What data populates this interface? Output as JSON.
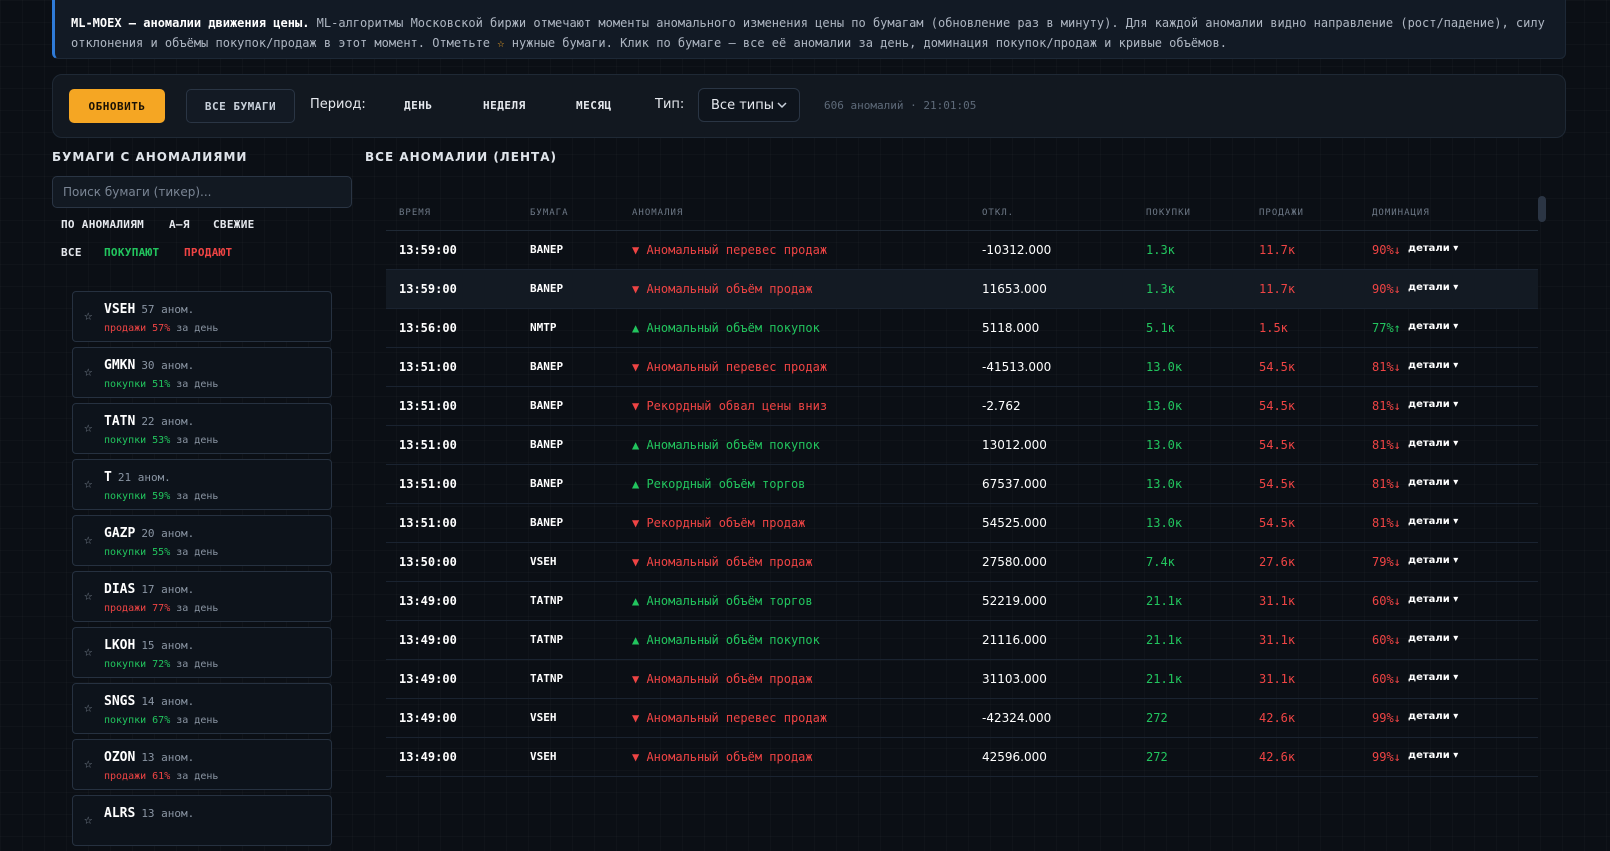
{
  "info": {
    "title": "ML-MOEX — аномалии движения цены.",
    "text_part1": " ML-алгоритмы Московской биржи отмечают моменты аномального изменения цены по бумагам (обновление раз в минуту). Для каждой аномалии видно направление (рост/падение), силу отклонения и объёмы покупок/продаж в этот момент. Отметьте ",
    "star_glyph": "☆",
    "text_part2": " нужные бумаги. Клик по бумаге — все её аномалии за день, доминация покупок/продаж и кривые объёмов."
  },
  "toolbar": {
    "refresh_label": "ОБНОВИТЬ",
    "all_label": "ВСЕ БУМАГИ",
    "period_label": "Период:",
    "periods": [
      "ДЕНЬ",
      "НЕДЕЛЯ",
      "МЕСЯЦ"
    ],
    "type_label": "Тип:",
    "type_value": "Все типы",
    "status": "606 аномалий · 21:01:05"
  },
  "sidebar": {
    "title": "БУМАГИ С АНОМАЛИЯМИ",
    "search_placeholder": "Поиск бумаги (тикер)...",
    "sort_options": [
      "ПО АНОМАЛИЯМ",
      "А–Я",
      "СВЕЖИЕ"
    ],
    "filters": [
      "ВСЕ",
      "ПОКУПАЮТ",
      "ПРОДАЮТ"
    ],
    "tickers": [
      {
        "name": "VSEH",
        "count": "57 аном.",
        "side": "sell",
        "dom": "продажи 57%",
        "suffix": "за день"
      },
      {
        "name": "GMKN",
        "count": "30 аном.",
        "side": "buy",
        "dom": "покупки 51%",
        "suffix": "за день"
      },
      {
        "name": "TATN",
        "count": "22 аном.",
        "side": "buy",
        "dom": "покупки 53%",
        "suffix": "за день"
      },
      {
        "name": "T",
        "count": "21 аном.",
        "side": "buy",
        "dom": "покупки 59%",
        "suffix": "за день"
      },
      {
        "name": "GAZP",
        "count": "20 аном.",
        "side": "buy",
        "dom": "покупки 55%",
        "suffix": "за день"
      },
      {
        "name": "DIAS",
        "count": "17 аном.",
        "side": "sell",
        "dom": "продажи 77%",
        "suffix": "за день"
      },
      {
        "name": "LKOH",
        "count": "15 аном.",
        "side": "buy",
        "dom": "покупки 72%",
        "suffix": "за день"
      },
      {
        "name": "SNGS",
        "count": "14 аном.",
        "side": "buy",
        "dom": "покупки 67%",
        "suffix": "за день"
      },
      {
        "name": "OZON",
        "count": "13 аном.",
        "side": "sell",
        "dom": "продажи 61%",
        "suffix": "за день"
      },
      {
        "name": "ALRS",
        "count": "13 аном.",
        "side": "buy",
        "dom": "",
        "suffix": ""
      }
    ]
  },
  "feed": {
    "title": "ВСЕ АНОМАЛИИ (ЛЕНТА)",
    "columns": [
      "ВРЕМЯ",
      "БУМАГА",
      "АНОМАЛИЯ",
      "ОТКЛ.",
      "ПОКУПКИ",
      "ПРОДАЖИ",
      "ДОМИНАЦИЯ"
    ],
    "details_label": "детали ▾",
    "rows": [
      {
        "time": "13:59:00",
        "sec": "BANEP",
        "dir": "down",
        "anomaly": "▼ Аномальный перевес продаж",
        "dev": "-10312.000",
        "buy": "1.3к",
        "sell": "11.7к",
        "dom": "90%↓"
      },
      {
        "time": "13:59:00",
        "sec": "BANEP",
        "dir": "down",
        "anomaly": "▼ Аномальный объём продаж",
        "dev": "11653.000",
        "buy": "1.3к",
        "sell": "11.7к",
        "dom": "90%↓"
      },
      {
        "time": "13:56:00",
        "sec": "NMTP",
        "dir": "up",
        "anomaly": "▲ Аномальный объём покупок",
        "dev": "5118.000",
        "buy": "5.1к",
        "sell": "1.5к",
        "dom": "77%↑"
      },
      {
        "time": "13:51:00",
        "sec": "BANEP",
        "dir": "down",
        "anomaly": "▼ Аномальный перевес продаж",
        "dev": "-41513.000",
        "buy": "13.0к",
        "sell": "54.5к",
        "dom": "81%↓"
      },
      {
        "time": "13:51:00",
        "sec": "BANEP",
        "dir": "down",
        "anomaly": "▼ Рекордный обвал цены вниз",
        "dev": "-2.762",
        "buy": "13.0к",
        "sell": "54.5к",
        "dom": "81%↓"
      },
      {
        "time": "13:51:00",
        "sec": "BANEP",
        "dir": "up",
        "anomaly": "▲ Аномальный объём покупок",
        "dev": "13012.000",
        "buy": "13.0к",
        "sell": "54.5к",
        "dom": "81%↓"
      },
      {
        "time": "13:51:00",
        "sec": "BANEP",
        "dir": "up",
        "anomaly": "▲ Рекордный объём торгов",
        "dev": "67537.000",
        "buy": "13.0к",
        "sell": "54.5к",
        "dom": "81%↓"
      },
      {
        "time": "13:51:00",
        "sec": "BANEP",
        "dir": "down",
        "anomaly": "▼ Рекордный объём продаж",
        "dev": "54525.000",
        "buy": "13.0к",
        "sell": "54.5к",
        "dom": "81%↓"
      },
      {
        "time": "13:50:00",
        "sec": "VSEH",
        "dir": "down",
        "anomaly": "▼ Аномальный объём продаж",
        "dev": "27580.000",
        "buy": "7.4к",
        "sell": "27.6к",
        "dom": "79%↓"
      },
      {
        "time": "13:49:00",
        "sec": "TATNP",
        "dir": "up",
        "anomaly": "▲ Аномальный объём торгов",
        "dev": "52219.000",
        "buy": "21.1к",
        "sell": "31.1к",
        "dom": "60%↓"
      },
      {
        "time": "13:49:00",
        "sec": "TATNP",
        "dir": "up",
        "anomaly": "▲ Аномальный объём покупок",
        "dev": "21116.000",
        "buy": "21.1к",
        "sell": "31.1к",
        "dom": "60%↓"
      },
      {
        "time": "13:49:00",
        "sec": "TATNP",
        "dir": "down",
        "anomaly": "▼ Аномальный объём продаж",
        "dev": "31103.000",
        "buy": "21.1к",
        "sell": "31.1к",
        "dom": "60%↓"
      },
      {
        "time": "13:49:00",
        "sec": "VSEH",
        "dir": "down",
        "anomaly": "▼ Аномальный перевес продаж",
        "dev": "-42324.000",
        "buy": "272",
        "sell": "42.6к",
        "dom": "99%↓"
      },
      {
        "time": "13:49:00",
        "sec": "VSEH",
        "dir": "down",
        "anomaly": "▼ Аномальный объём продаж",
        "dev": "42596.000",
        "buy": "272",
        "sell": "42.6к",
        "dom": "99%↓"
      }
    ]
  },
  "colors": {
    "accent": "#f5a623",
    "buy": "#22c55e",
    "sell": "#ef4444",
    "info_border": "#2f7bd8"
  }
}
